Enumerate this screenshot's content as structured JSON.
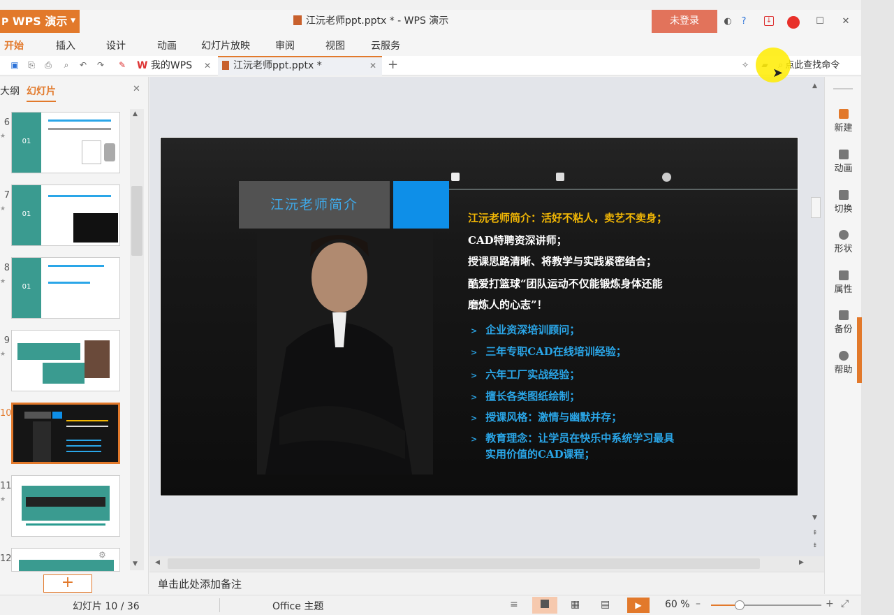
{
  "app": {
    "name": "WPS 演示",
    "doc_title": "江沅老师ppt.pptx * - WPS 演示",
    "login": "未登录"
  },
  "menu": [
    "开始",
    "插入",
    "设计",
    "动画",
    "幻灯片放映",
    "审阅",
    "视图",
    "云服务"
  ],
  "tabs": [
    {
      "label": "我的WPS"
    },
    {
      "label": "江沅老师ppt.pptx *"
    }
  ],
  "search": {
    "label": "点此查找命令"
  },
  "left_pane": {
    "tabs": [
      "大纲",
      "幻灯片"
    ],
    "slides": [
      {
        "num": "6",
        "cover": "01"
      },
      {
        "num": "7",
        "cover": "01"
      },
      {
        "num": "8",
        "cover": "01"
      },
      {
        "num": "9"
      },
      {
        "num": "10",
        "selected": true
      },
      {
        "num": "11"
      },
      {
        "num": "12"
      }
    ],
    "add_label": "+"
  },
  "slide": {
    "heading": "江沅老师简介",
    "intro_title": "江沅老师简介：活好不粘人，卖艺不卖身；",
    "intro_lines": [
      "CAD特聘资深讲师；",
      "授课思路清晰、将教学与实践紧密结合；",
      "酷爱打篮球“团队运动不仅能锻炼身体还能",
      "磨炼人的心志”！"
    ],
    "bullets": [
      "企业资深培训顾问；",
      "三年专职CAD在线培训经验；",
      "六年工厂实战经验；",
      "擅长各类图纸绘制；",
      "授课风格：激情与幽默并存；",
      "教育理念：让学员在快乐中系统学习最具"
    ],
    "bullet_continue": "实用价值的CAD课程；",
    "colors": {
      "accent_blue": "#0e8fe8",
      "title_yellow": "#f2b705",
      "bullet_blue": "#2aa6e8",
      "gray_box": "#525252"
    }
  },
  "right_pane": {
    "tools": [
      "新建",
      "动画",
      "切换",
      "形状",
      "属性",
      "备份",
      "帮助"
    ]
  },
  "notes": {
    "placeholder": "单击此处添加备注"
  },
  "status": {
    "slide_counter": "幻灯片 10 / 36",
    "theme": "Office 主题",
    "zoom": "60 %"
  }
}
